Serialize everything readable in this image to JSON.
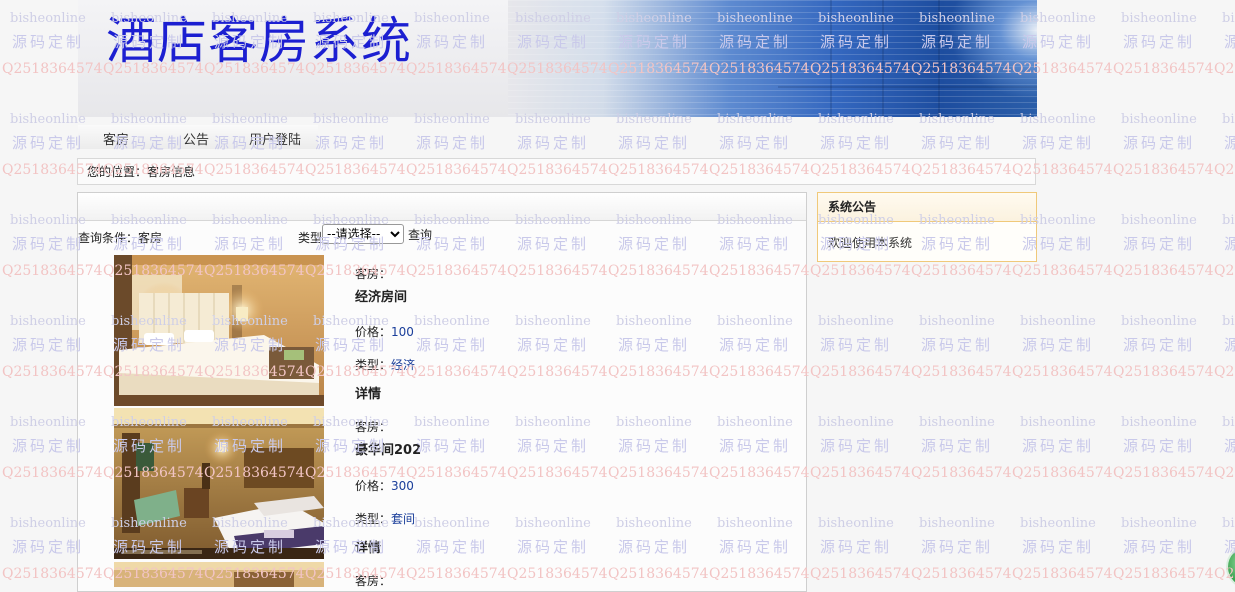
{
  "header": {
    "title": "酒店客房系统"
  },
  "nav": {
    "items": [
      {
        "label": "客房"
      },
      {
        "label": "公告"
      },
      {
        "label": "用户登陆"
      }
    ]
  },
  "breadcrumb": {
    "text": "您的位置：客房信息"
  },
  "query": {
    "condition_label": "查询条件：客房",
    "type_label": "类型",
    "select_selected": "--请选择--",
    "button_label": "查询"
  },
  "rooms": [
    {
      "field_label": "客房：",
      "name": "经济房间",
      "price_label": "价格：",
      "price": "100",
      "type_label": "类型：",
      "type": "经济",
      "detail_label": "详情"
    },
    {
      "field_label": "客房：",
      "name": "豪华间202",
      "price_label": "价格：",
      "price": "300",
      "type_label": "类型：",
      "type": "套间",
      "detail_label": "详情"
    },
    {
      "field_label": "客房："
    }
  ],
  "notice": {
    "title": "系统公告",
    "text": "欢迎使用本系统"
  },
  "watermark": {
    "line1": "bisheonline",
    "line2": "源码定制",
    "line3": "Q2518364574"
  },
  "colors": {
    "title_blue": "#1c1fd1",
    "link_blue": "#1a3e9a",
    "notice_border": "#f0c97a"
  }
}
